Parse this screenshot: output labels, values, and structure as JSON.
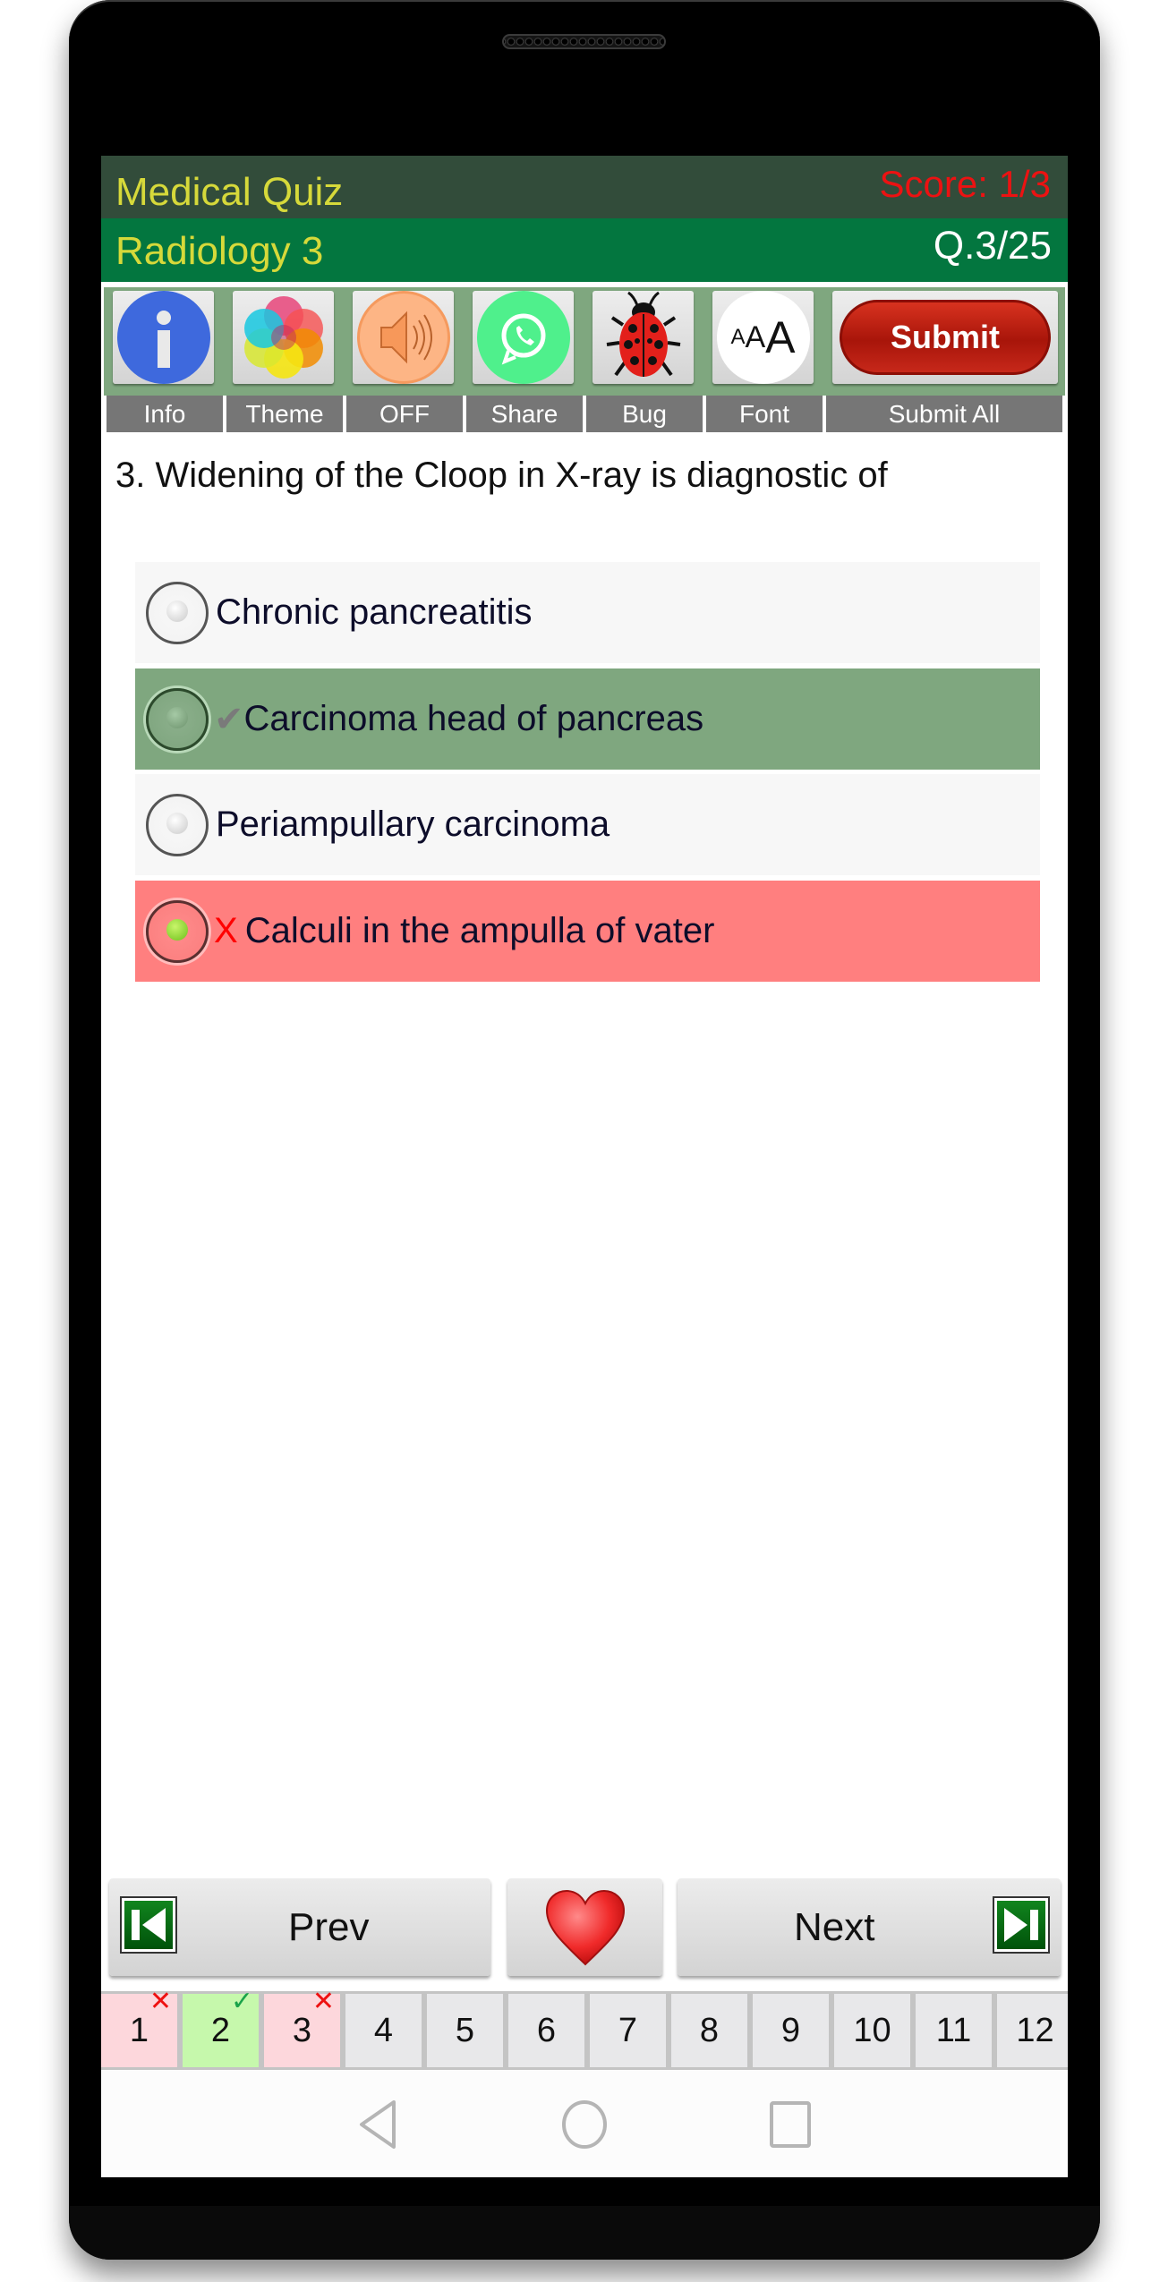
{
  "header": {
    "app_title": "Medical Quiz",
    "score": "Score: 1/3",
    "quiz_name": "Radiology 3",
    "question_counter": "Q.3/25"
  },
  "toolbar": {
    "buttons": [
      {
        "id": "info",
        "icon": "info-icon",
        "label": "Info"
      },
      {
        "id": "theme",
        "icon": "palette-icon",
        "label": "Theme"
      },
      {
        "id": "sound",
        "icon": "speaker-icon",
        "label": "OFF"
      },
      {
        "id": "share",
        "icon": "whatsapp-icon",
        "label": "Share"
      },
      {
        "id": "bug",
        "icon": "ladybug-icon",
        "label": "Bug"
      },
      {
        "id": "font",
        "icon": "font-size-icon",
        "label": "Font",
        "glyph_small": "A",
        "glyph_mid": "A",
        "glyph_big": "A"
      },
      {
        "id": "submit",
        "icon": "submit-pill",
        "label": "Submit All",
        "button_text": "Submit"
      }
    ]
  },
  "question": {
    "text": "3. Widening of the Cloop in X-ray is diagnostic of",
    "options": [
      {
        "text": "Chronic pancreatitis",
        "state": "neutral",
        "mark": "",
        "selected": false
      },
      {
        "text": "Carcinoma head of pancreas",
        "state": "correct",
        "mark": "✔",
        "selected": false
      },
      {
        "text": "Periampullary carcinoma",
        "state": "neutral",
        "mark": "",
        "selected": false
      },
      {
        "text": "Calculi in the ampulla of vater",
        "state": "wrong",
        "mark": "X",
        "selected": true
      }
    ]
  },
  "navigation": {
    "prev_label": "Prev",
    "next_label": "Next",
    "favorite_icon": "heart-icon"
  },
  "question_strip": [
    {
      "n": "1",
      "status": "wrong",
      "badge": "✕"
    },
    {
      "n": "2",
      "status": "right",
      "badge": "✓"
    },
    {
      "n": "3",
      "status": "wrong",
      "badge": "✕"
    },
    {
      "n": "4",
      "status": "unanswered",
      "badge": ""
    },
    {
      "n": "5",
      "status": "unanswered",
      "badge": ""
    },
    {
      "n": "6",
      "status": "unanswered",
      "badge": ""
    },
    {
      "n": "7",
      "status": "unanswered",
      "badge": ""
    },
    {
      "n": "8",
      "status": "unanswered",
      "badge": ""
    },
    {
      "n": "9",
      "status": "unanswered",
      "badge": ""
    },
    {
      "n": "10",
      "status": "unanswered",
      "badge": ""
    },
    {
      "n": "11",
      "status": "unanswered",
      "badge": ""
    },
    {
      "n": "12",
      "status": "unanswered",
      "badge": ""
    }
  ],
  "system_nav": [
    "back-icon",
    "home-icon",
    "recents-icon"
  ],
  "colors": {
    "header_dark": "#324c3a",
    "header_green": "#03763f",
    "title_yellow": "#d6d93a",
    "score_red": "#ec1212",
    "correct_bg": "#7fa77f",
    "wrong_bg": "#ff7f7f"
  }
}
